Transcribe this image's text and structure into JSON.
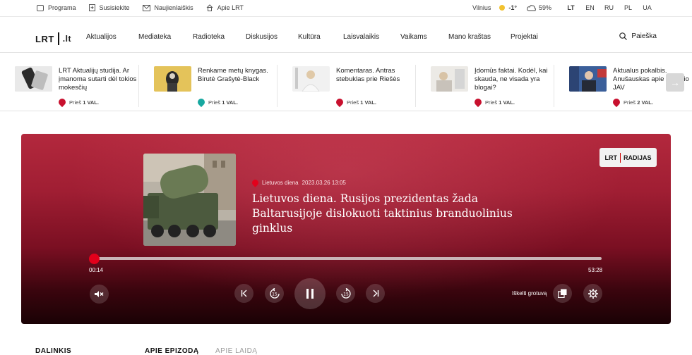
{
  "topbar": {
    "links": [
      "Programa",
      "Susisiekite",
      "Naujienlaiškis",
      "Apie LRT"
    ],
    "weather": {
      "city": "Vilnius",
      "temp": "-1°",
      "humidity": "59%"
    },
    "languages": [
      "LT",
      "EN",
      "RU",
      "PL",
      "UA"
    ],
    "active_language": "LT"
  },
  "nav": {
    "logo_main": "LRT",
    "logo_suffix": ".lt",
    "items": [
      "Aktualijos",
      "Mediateka",
      "Radioteka",
      "Diskusijos",
      "Kultūra",
      "Laisvalaikis",
      "Vaikams",
      "Mano kraštas",
      "Projektai"
    ],
    "search_label": "Paieška"
  },
  "strip": {
    "cards": [
      {
        "title": "LRT Aktualijų studija. Ar įmanoma sutarti dėl tokios mokesčių",
        "time_prefix": "Prieš",
        "time_value": "1 VAL.",
        "pin_color": "#c8102e"
      },
      {
        "title": "Renkame metų knygas. Birutė Grašytė-Black",
        "time_prefix": "Prieš",
        "time_value": "1 VAL.",
        "pin_color": "#17a8a0"
      },
      {
        "title": "Komentaras. Antras stebuklas prie Riešės",
        "time_prefix": "Prieš",
        "time_value": "1 VAL.",
        "pin_color": "#c8102e"
      },
      {
        "title": "Įdomūs faktai. Kodėl, kai skauda, ne visada yra blogai?",
        "time_prefix": "Prieš",
        "time_value": "1 VAL.",
        "pin_color": "#c8102e"
      },
      {
        "title": "Aktualus pokalbis. Anušauskas apie buvusio JAV",
        "time_prefix": "Prieš",
        "time_value": "2 VAL.",
        "pin_color": "#c8102e"
      }
    ],
    "next_arrow": "→"
  },
  "player": {
    "badge_left": "LRT",
    "badge_right": "RADIJAS",
    "show": "Lietuvos diena",
    "datetime": "2023.03.26 13:05",
    "title": "Lietuvos diena. Rusijos prezidentas žada Baltarusijoje dislokuoti taktinius branduolinius ginklus",
    "current_time": "00:14",
    "duration": "53:28",
    "progress_fraction": 0.0044,
    "popout_label": "Iškelti grotuvą",
    "accent": "#e3001b"
  },
  "below": {
    "share": "DALINKIS",
    "tabs": [
      "APIE EPIZODĄ",
      "APIE LAIDĄ"
    ]
  }
}
